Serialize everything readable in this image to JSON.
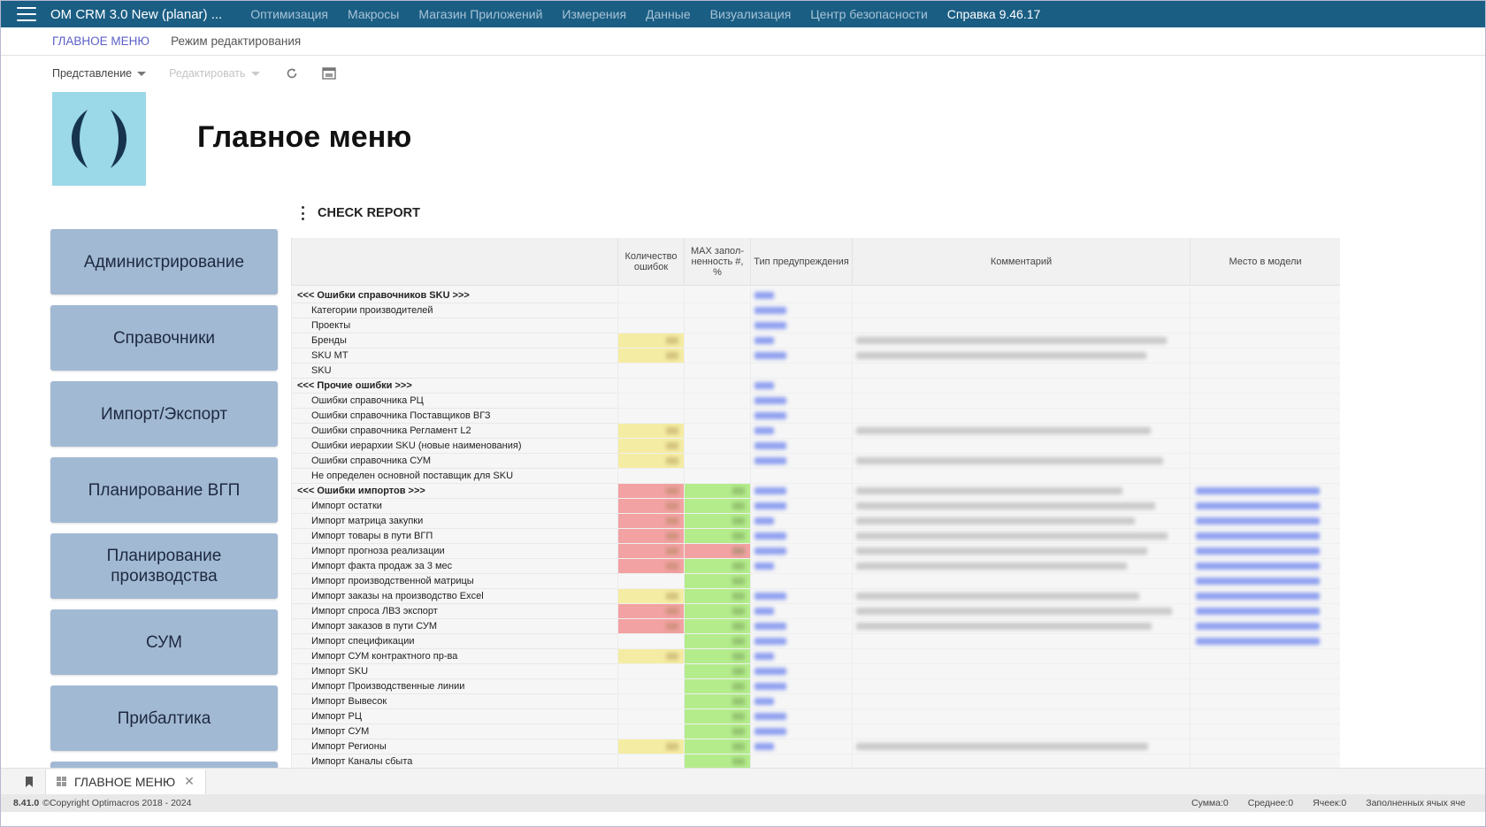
{
  "topbar": {
    "title": "OM CRM 3.0 New (planar) ...",
    "nav": [
      "Оптимизация",
      "Макросы",
      "Магазин Приложений",
      "Измерения",
      "Данные",
      "Визуализация",
      "Центр безопасности"
    ],
    "help": "Справка 9.46.17"
  },
  "secbar": {
    "active_tab": "ГЛАВНОЕ МЕНЮ",
    "mode_tab": "Режим редактирования"
  },
  "toolbar": {
    "view": "Представление",
    "edit": "Редактировать"
  },
  "page": {
    "title": "Главное меню"
  },
  "menu": [
    "Администрирование",
    "Справочники",
    "Импорт/Экспорт",
    "Планирование ВГП",
    "Планирование производства",
    "СУМ",
    "Прибалтика"
  ],
  "report": {
    "title": "CHECK REPORT",
    "headers": {
      "count": "Количество ошибок",
      "max": "MAX запол-ненность #, %",
      "type": "Тип предупреждения",
      "comment": "Комментарий",
      "place": "Место в модели"
    },
    "rows": [
      {
        "name": "<<< Ошибки справочников SKU >>>",
        "group": true,
        "cnt": "",
        "max": "",
        "t": 1,
        "c": 0,
        "p": 0
      },
      {
        "name": "Категории производителей",
        "group": false,
        "cnt": "",
        "max": "",
        "t": 1,
        "c": 0,
        "p": 0
      },
      {
        "name": "Проекты",
        "group": false,
        "cnt": "",
        "max": "",
        "t": 1,
        "c": 0,
        "p": 0
      },
      {
        "name": "Бренды",
        "group": false,
        "cnt": "yellow",
        "max": "",
        "t": 1,
        "c": 1,
        "p": 0
      },
      {
        "name": "SKU MT",
        "group": false,
        "cnt": "yellow",
        "max": "",
        "t": 1,
        "c": 1,
        "p": 0
      },
      {
        "name": "SKU",
        "group": false,
        "cnt": "",
        "max": "",
        "t": 0,
        "c": 0,
        "p": 0
      },
      {
        "name": "<<< Прочие ошибки >>>",
        "group": true,
        "cnt": "",
        "max": "",
        "t": 1,
        "c": 0,
        "p": 0
      },
      {
        "name": "Ошибки справочника РЦ",
        "group": false,
        "cnt": "",
        "max": "",
        "t": 1,
        "c": 0,
        "p": 0
      },
      {
        "name": "Ошибки справочника Поставщиков ВГЗ",
        "group": false,
        "cnt": "",
        "max": "",
        "t": 1,
        "c": 0,
        "p": 0
      },
      {
        "name": "Ошибки справочника Регламент L2",
        "group": false,
        "cnt": "yellow",
        "max": "",
        "t": 1,
        "c": 1,
        "p": 0
      },
      {
        "name": "Ошибки иерархии SKU (новые наименования)",
        "group": false,
        "cnt": "yellow",
        "max": "",
        "t": 1,
        "c": 0,
        "p": 0
      },
      {
        "name": "Ошибки справочника СУМ",
        "group": false,
        "cnt": "yellow",
        "max": "",
        "t": 1,
        "c": 1,
        "p": 0
      },
      {
        "name": "Не определен основной поставщик для SKU",
        "group": false,
        "cnt": "",
        "max": "",
        "t": 0,
        "c": 0,
        "p": 0
      },
      {
        "name": "<<< Ошибки импортов >>>",
        "group": true,
        "cnt": "red",
        "max": "green",
        "t": 1,
        "c": 1,
        "p": 1
      },
      {
        "name": "Импорт остатки",
        "group": false,
        "cnt": "red",
        "max": "green",
        "t": 1,
        "c": 1,
        "p": 1
      },
      {
        "name": "Импорт матрица закупки",
        "group": false,
        "cnt": "red",
        "max": "green",
        "t": 1,
        "c": 1,
        "p": 1
      },
      {
        "name": "Импорт товары в пути ВГП",
        "group": false,
        "cnt": "red",
        "max": "green",
        "t": 1,
        "c": 1,
        "p": 1
      },
      {
        "name": "Импорт прогноза реализации",
        "group": false,
        "cnt": "red",
        "max": "red",
        "t": 1,
        "c": 1,
        "p": 1
      },
      {
        "name": "Импорт факта продаж за 3 мес",
        "group": false,
        "cnt": "red",
        "max": "green",
        "t": 1,
        "c": 1,
        "p": 1
      },
      {
        "name": "Импорт производственной матрицы",
        "group": false,
        "cnt": "",
        "max": "green",
        "t": 0,
        "c": 0,
        "p": 1
      },
      {
        "name": "Импорт заказы на производство Excel",
        "group": false,
        "cnt": "yellow",
        "max": "green",
        "t": 1,
        "c": 1,
        "p": 1
      },
      {
        "name": "Импорт спроса ЛВЗ экспорт",
        "group": false,
        "cnt": "red",
        "max": "green",
        "t": 1,
        "c": 1,
        "p": 1
      },
      {
        "name": "Импорт заказов в пути СУМ",
        "group": false,
        "cnt": "red",
        "max": "green",
        "t": 1,
        "c": 1,
        "p": 1
      },
      {
        "name": "Импорт спецификации",
        "group": false,
        "cnt": "",
        "max": "green",
        "t": 1,
        "c": 0,
        "p": 1
      },
      {
        "name": "Импорт СУМ контрактного пр-ва",
        "group": false,
        "cnt": "yellow",
        "max": "green",
        "t": 1,
        "c": 0,
        "p": 0
      },
      {
        "name": "Импорт SKU",
        "group": false,
        "cnt": "",
        "max": "green",
        "t": 1,
        "c": 0,
        "p": 0
      },
      {
        "name": "Импорт Производственные линии",
        "group": false,
        "cnt": "",
        "max": "green",
        "t": 1,
        "c": 0,
        "p": 0
      },
      {
        "name": "Импорт Вывесок",
        "group": false,
        "cnt": "",
        "max": "green",
        "t": 1,
        "c": 0,
        "p": 0
      },
      {
        "name": "Импорт РЦ",
        "group": false,
        "cnt": "",
        "max": "green",
        "t": 1,
        "c": 0,
        "p": 0
      },
      {
        "name": "Импорт СУМ",
        "group": false,
        "cnt": "",
        "max": "green",
        "t": 1,
        "c": 0,
        "p": 0
      },
      {
        "name": "Импорт Регионы",
        "group": false,
        "cnt": "yellow",
        "max": "green",
        "t": 1,
        "c": 1,
        "p": 0
      },
      {
        "name": "Импорт Каналы сбыта",
        "group": false,
        "cnt": "",
        "max": "green",
        "t": 0,
        "c": 0,
        "p": 0
      }
    ]
  },
  "tabbar": {
    "tab": "ГЛАВНОЕ МЕНЮ"
  },
  "status": {
    "version": "8.41.0",
    "copyright": "©Copyright Optimacros 2018 - 2024",
    "sum": "Сумма:0",
    "avg": "Среднее:0",
    "cells": "Ячеек:0",
    "filled": "Заполненных ячых яче"
  },
  "colors": {
    "topbar": "#1b5e84",
    "menu_button": "#a2b9d3",
    "active_tab": "#5b5fc7",
    "logo_bg": "#9bd8e8",
    "logo_mark": "#17344f",
    "cell_yellow": "#f5eca3",
    "cell_red": "#f2a2a2",
    "cell_green": "#b4ec8c",
    "link_blue": "#8fa0f0"
  }
}
